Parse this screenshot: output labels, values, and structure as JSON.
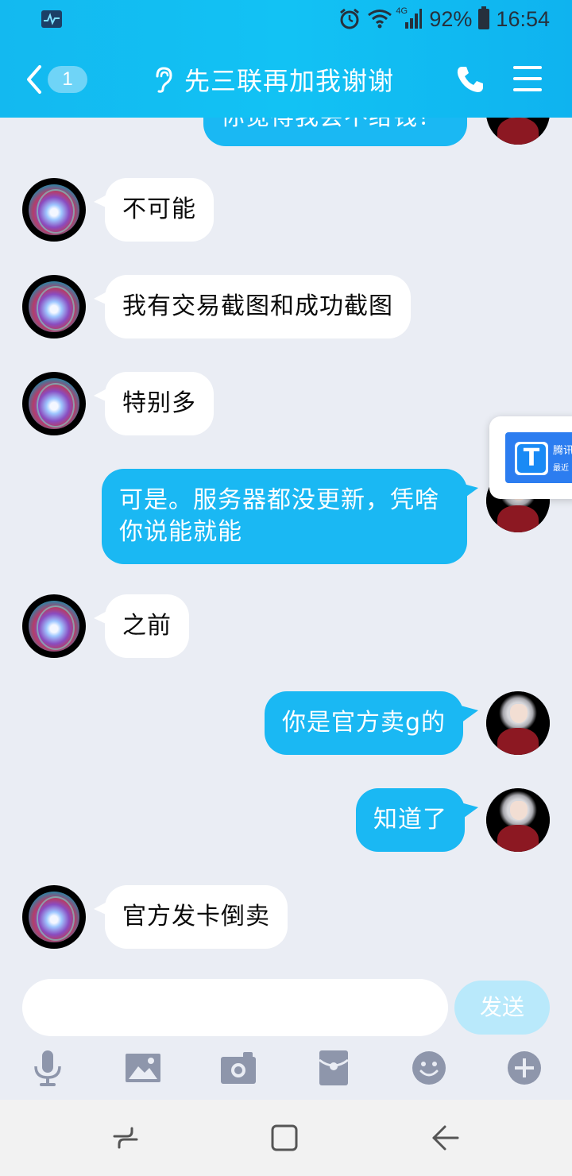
{
  "status_bar": {
    "battery": "92%",
    "time": "16:54",
    "network": "4G"
  },
  "header": {
    "badge": "1",
    "title": "先三联再加我谢谢"
  },
  "colors": {
    "header_gradient": "#12c2f4",
    "outgoing_bubble": "#1ab8f3",
    "incoming_bubble": "#ffffff",
    "background": "#eaedf4",
    "send_button": "#b9e9fb"
  },
  "messages": [
    {
      "side": "right",
      "text": "你觉得我会不给钱？"
    },
    {
      "side": "left",
      "text": "不可能"
    },
    {
      "side": "left",
      "text": "我有交易截图和成功截图"
    },
    {
      "side": "left",
      "text": "特别多"
    },
    {
      "side": "right",
      "text": "可是。服务器都没更新，凭啥你说能就能"
    },
    {
      "side": "left",
      "text": "之前"
    },
    {
      "side": "right",
      "text": "你是官方卖g的"
    },
    {
      "side": "right",
      "text": "知道了"
    },
    {
      "side": "left",
      "text": "官方发卡倒卖"
    }
  ],
  "float_widget": {
    "title": "腾讯",
    "subtitle": "最近"
  },
  "input": {
    "value": "",
    "send_label": "发送"
  },
  "toolbar": [
    "mic-icon",
    "image-icon",
    "camera-icon",
    "red-packet-icon",
    "emoji-icon",
    "plus-icon"
  ],
  "navbar": [
    "recent-apps-icon",
    "home-icon",
    "back-nav-icon"
  ]
}
